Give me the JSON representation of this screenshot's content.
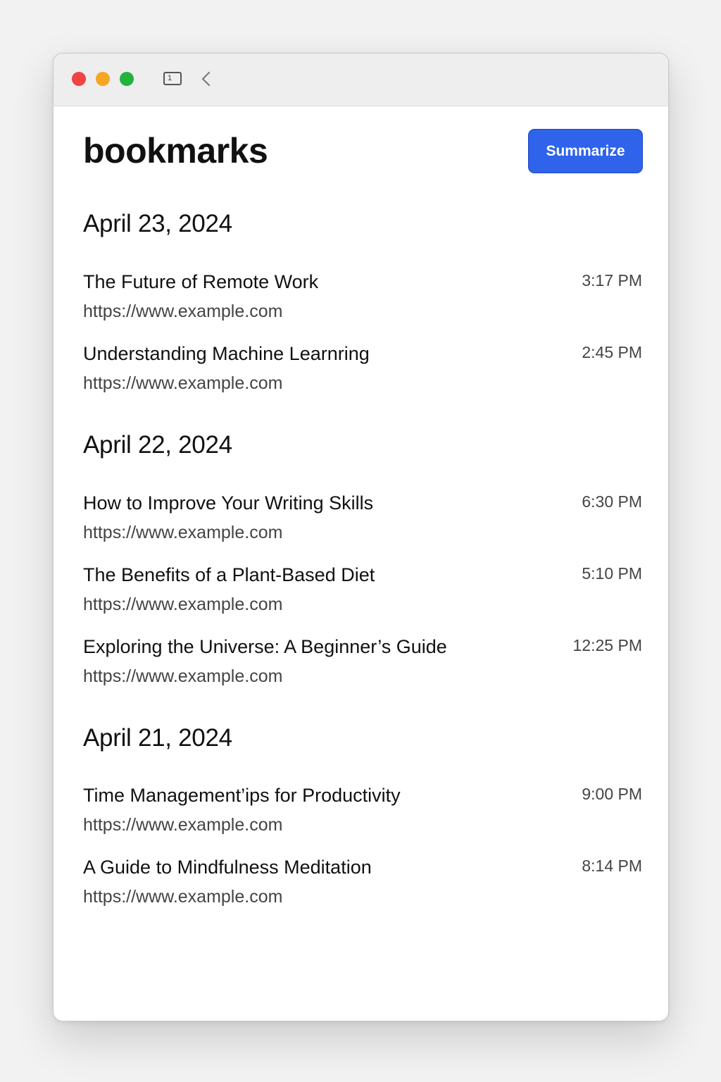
{
  "window": {
    "titlebar": {
      "tab_icon_label": "1",
      "controls": [
        "close",
        "minimize",
        "zoom"
      ]
    }
  },
  "page": {
    "title": "bookmarks",
    "summarize_label": "Summarize",
    "accent_color": "#2f63ea"
  },
  "groups": [
    {
      "date": "April 23, 2024",
      "items": [
        {
          "title": "The Future of Remote Work",
          "url": "https://www.example.com",
          "time": "3:17 PM"
        },
        {
          "title": "Understanding Machine Learnring",
          "url": "https://www.example.com",
          "time": "2:45 PM"
        }
      ]
    },
    {
      "date": "April 22, 2024",
      "items": [
        {
          "title": "How to Improve Your Writing Skills",
          "url": "https://www.example.com",
          "time": "6:30 PM"
        },
        {
          "title": "The Benefits of a Plant-Based Diet",
          "url": "https://www.example.com",
          "time": "5:10 PM"
        },
        {
          "title": "Exploring the Universe:  A Beginner’s Guide",
          "url": "https://www.example.com",
          "time": "12:25 PM"
        }
      ]
    },
    {
      "date": "April 21, 2024",
      "items": [
        {
          "title": "Time Management’ips for Productivity",
          "url": "https://www.example.com",
          "time": "9:00 PM"
        },
        {
          "title": "A Guide to Mindfulness Meditation",
          "url": "https://www.example.com",
          "time": "8:14 PM"
        }
      ]
    }
  ]
}
